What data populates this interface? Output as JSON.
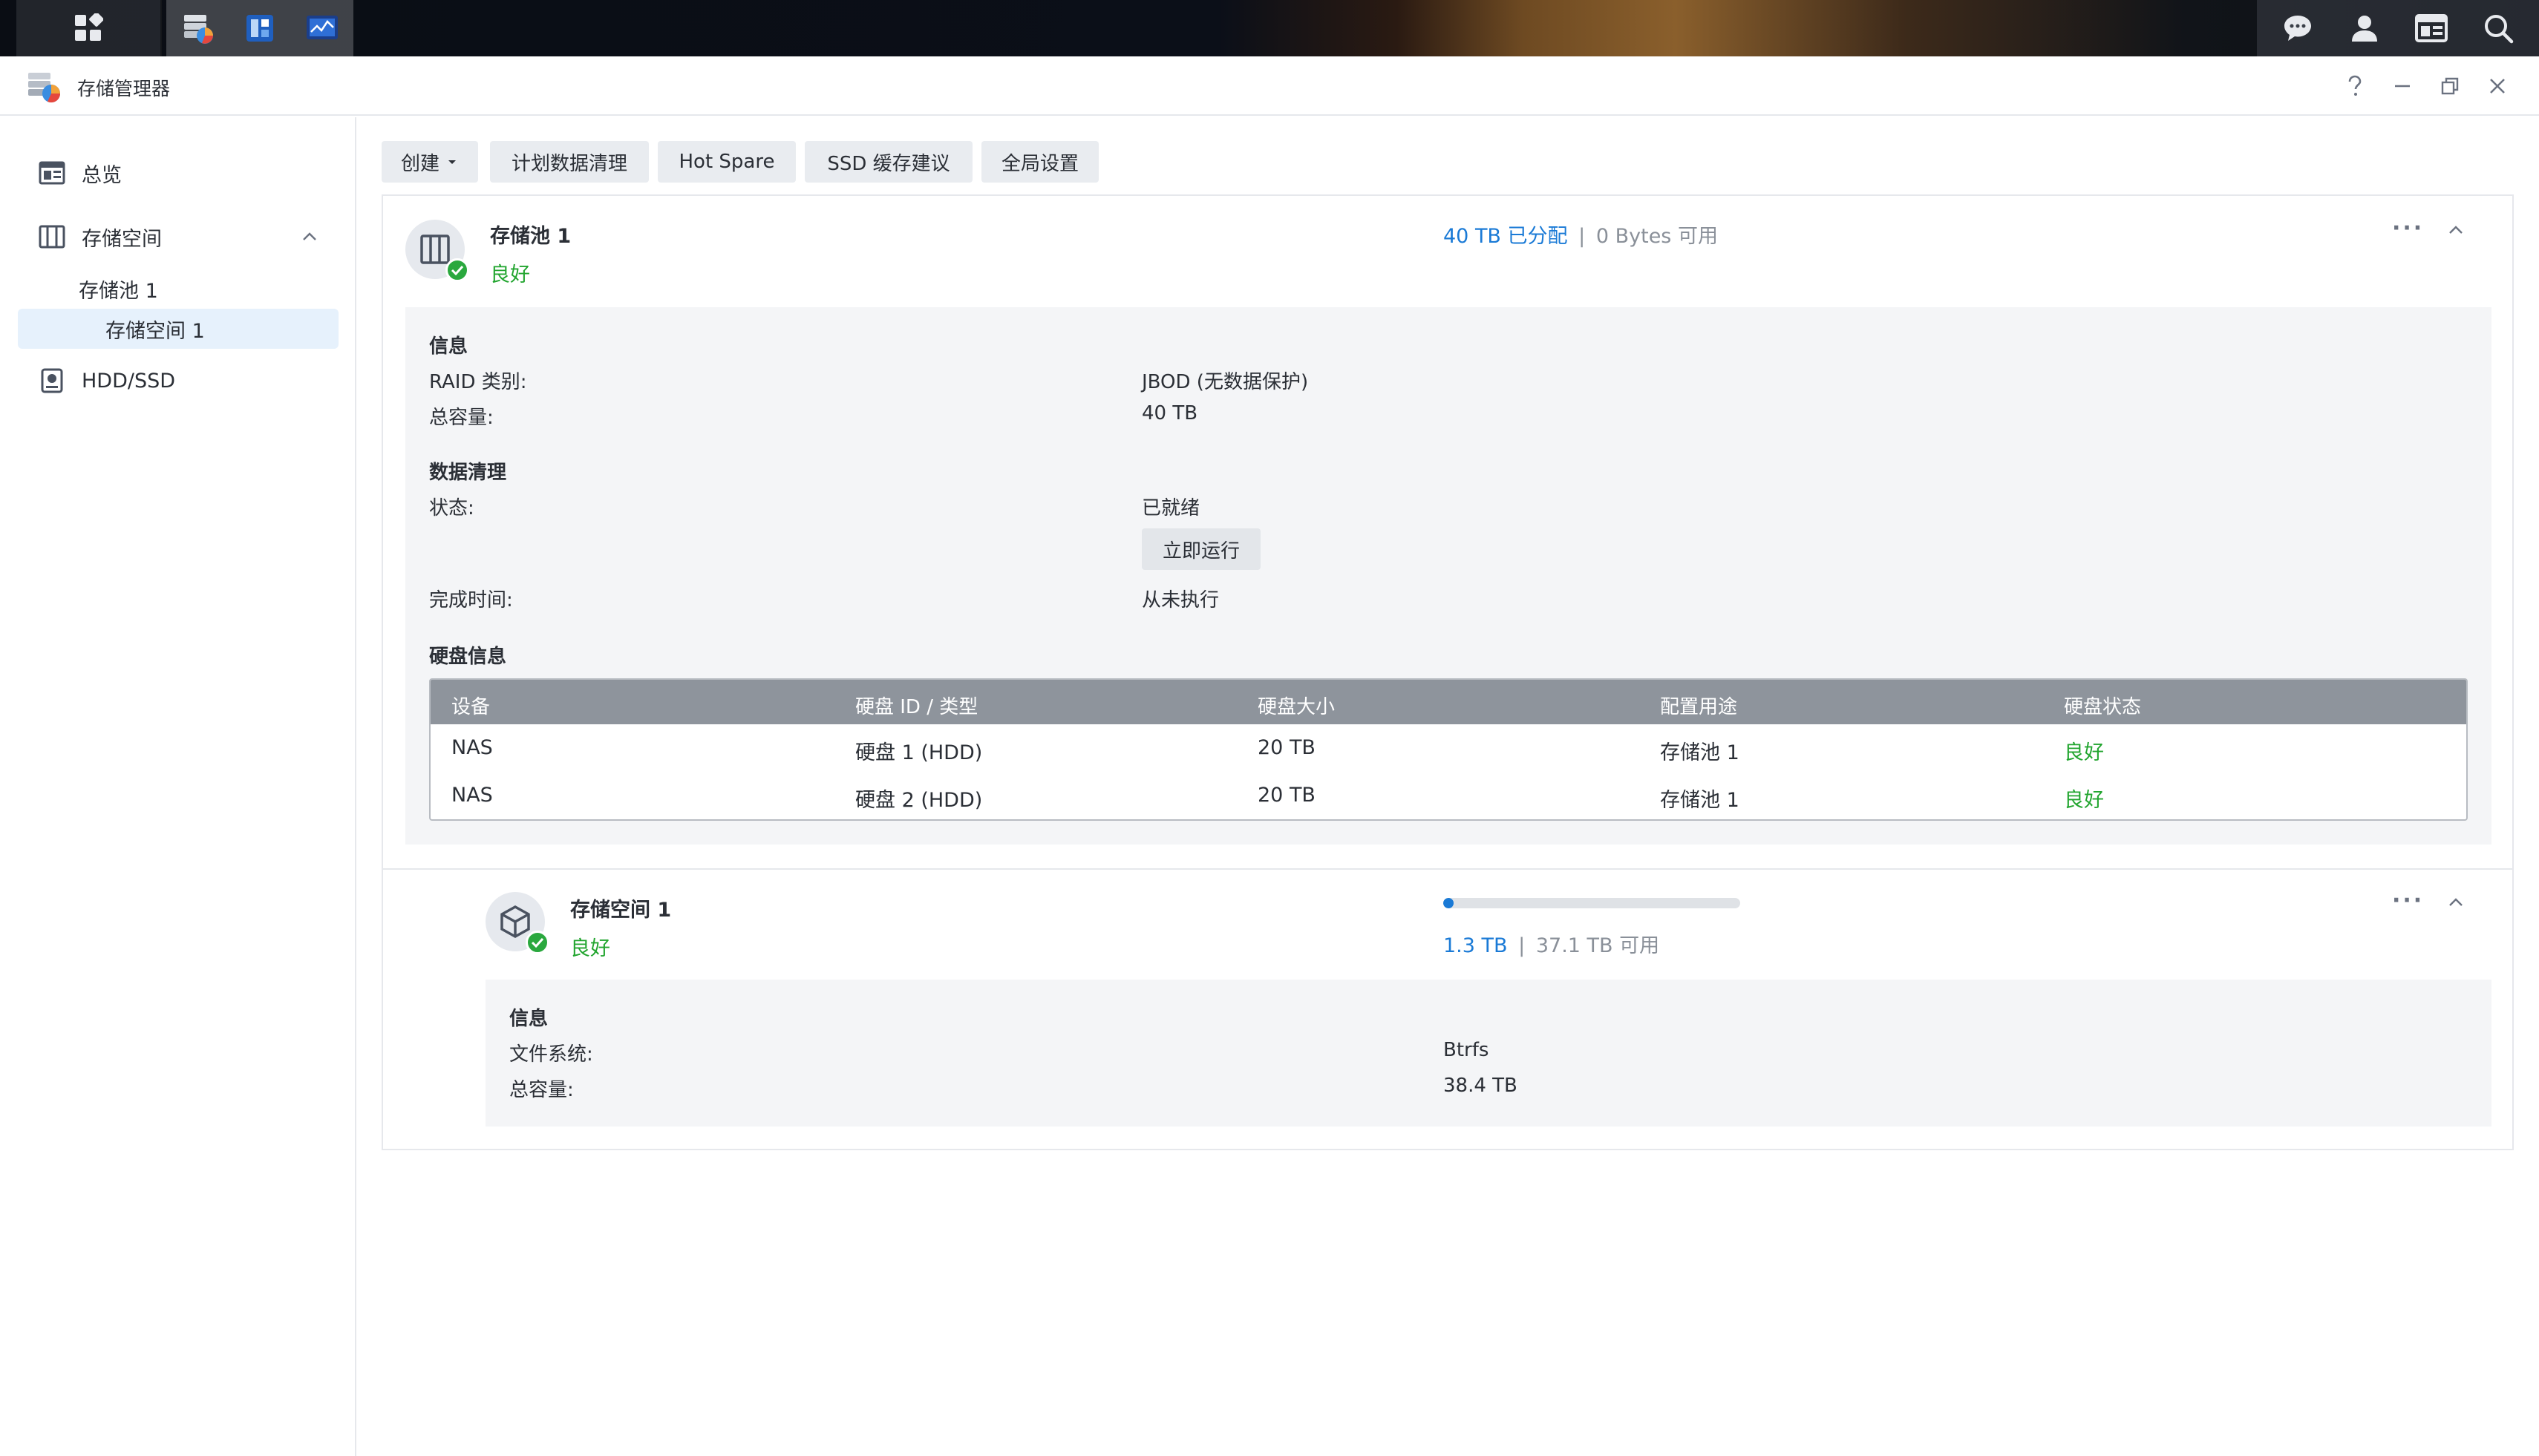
{
  "window": {
    "title": "存储管理器"
  },
  "sidebar": {
    "items": [
      {
        "label": "总览",
        "icon": "overview-icon"
      },
      {
        "label": "存储空间",
        "icon": "storage-icon"
      },
      {
        "label": "存储池 1"
      },
      {
        "label": "存储空间 1"
      },
      {
        "label": "HDD/SSD",
        "icon": "disk-icon"
      }
    ]
  },
  "toolbar": {
    "create": "创建",
    "scrub_schedule": "计划数据清理",
    "hot_spare": "Hot Spare",
    "ssd_advice": "SSD 缓存建议",
    "global_settings": "全局设置"
  },
  "pool": {
    "title": "存储池 1",
    "status": "良好",
    "allocated": "40 TB 已分配",
    "separator": "|",
    "available": "0 Bytes 可用",
    "info": {
      "heading": "信息",
      "raid_label": "RAID 类别:",
      "raid_value": "JBOD (无数据保护)",
      "capacity_label": "总容量:",
      "capacity_value": "40 TB"
    },
    "scrub": {
      "heading": "数据清理",
      "state_label": "状态:",
      "state_value": "已就绪",
      "run_now": "立即运行",
      "finish_label": "完成时间:",
      "finish_value": "从未执行"
    },
    "disks": {
      "heading": "硬盘信息",
      "columns": [
        "设备",
        "硬盘 ID / 类型",
        "硬盘大小",
        "配置用途",
        "硬盘状态"
      ],
      "rows": [
        [
          "NAS",
          "硬盘 1 (HDD)",
          "20 TB",
          "存储池 1",
          "良好"
        ],
        [
          "NAS",
          "硬盘 2 (HDD)",
          "20 TB",
          "存储池 1",
          "良好"
        ]
      ]
    }
  },
  "volume": {
    "title": "存储空间 1",
    "status": "良好",
    "used": "1.3 TB",
    "separator": "|",
    "available": "37.1 TB 可用",
    "usage_fraction": 0.035,
    "info": {
      "heading": "信息",
      "fs_label": "文件系统:",
      "fs_value": "Btrfs",
      "capacity_label": "总容量:",
      "capacity_value": "38.4 TB"
    }
  },
  "colors": {
    "accent": "#1a7ad6",
    "good": "#22a52f",
    "table_header": "#8e949c",
    "selected_bg": "#e6f1fc"
  }
}
